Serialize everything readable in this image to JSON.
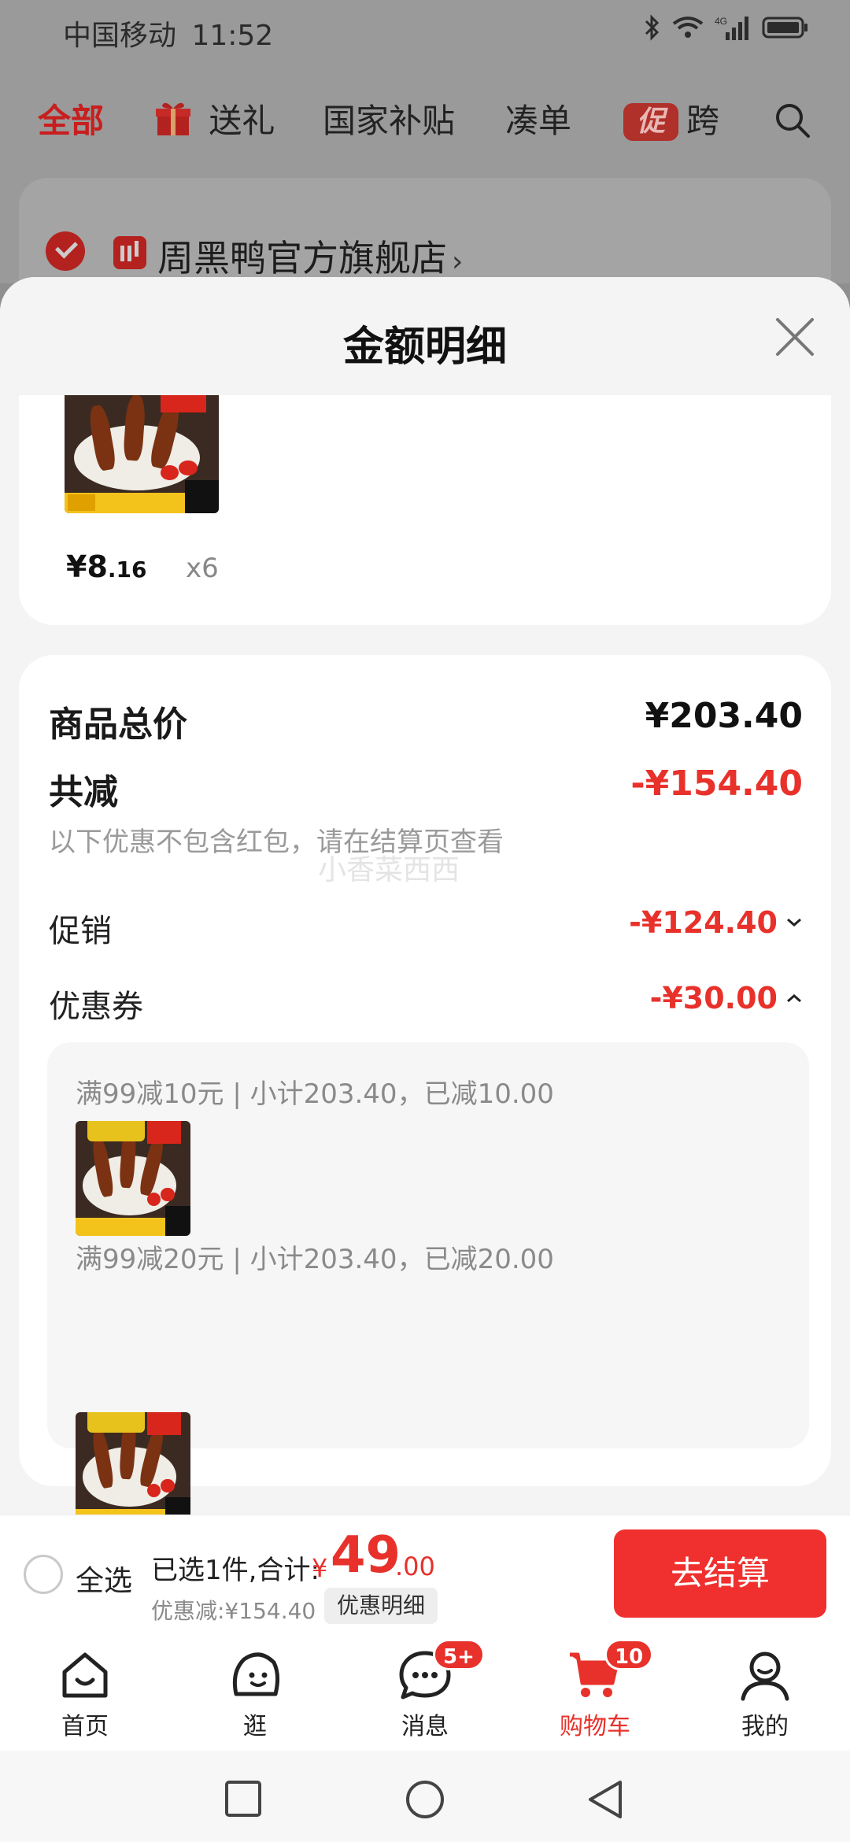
{
  "status": {
    "carrier": "中国移动",
    "time": "11:52"
  },
  "top_tabs": [
    {
      "label": "全部"
    },
    {
      "label": "送礼"
    },
    {
      "label": "国家补贴"
    },
    {
      "label": "凑单"
    },
    {
      "label": "跨",
      "badge": "促"
    }
  ],
  "store": {
    "name": "周黑鸭官方旗舰店",
    "chevron": "›"
  },
  "sheet": {
    "title": "金额明细",
    "close_icon": "close-icon"
  },
  "top_item": {
    "price_int": "¥8",
    "price_dec": ".16",
    "quantity": "x6"
  },
  "summary": {
    "total_label": "商品总价",
    "total_value": "¥203.40",
    "reduce_label": "共减",
    "reduce_value": "-¥154.40",
    "reduce_note": "以下优惠不包含红包，请在结算页查看",
    "watermark": "小香菜西西",
    "promo_label": "促销",
    "promo_value": "-¥124.40",
    "coupon_label": "优惠券",
    "coupon_value": "-¥30.00"
  },
  "coupons": [
    {
      "text": "满99减10元 | 小计203.40，已减10.00"
    },
    {
      "text": "满99减20元 | 小计203.40，已减20.00"
    }
  ],
  "checkout": {
    "select_all": "全选",
    "selected_text": "已选1件,合计:",
    "yen": "¥",
    "sum_int": "49",
    "sum_dec": ".00",
    "discount_text": "优惠减:¥154.40",
    "detail_chip": "优惠明细",
    "checkout_button": "去结算"
  },
  "nav": [
    {
      "label": "首页",
      "icon": "home-icon"
    },
    {
      "label": "逛",
      "icon": "browse-face-icon"
    },
    {
      "label": "消息",
      "icon": "message-icon",
      "badge": "5+"
    },
    {
      "label": "购物车",
      "icon": "cart-icon",
      "badge": "10",
      "active": true
    },
    {
      "label": "我的",
      "icon": "profile-icon"
    }
  ],
  "colors": {
    "accent": "#e8312b",
    "checkout_button": "#f0302e"
  }
}
